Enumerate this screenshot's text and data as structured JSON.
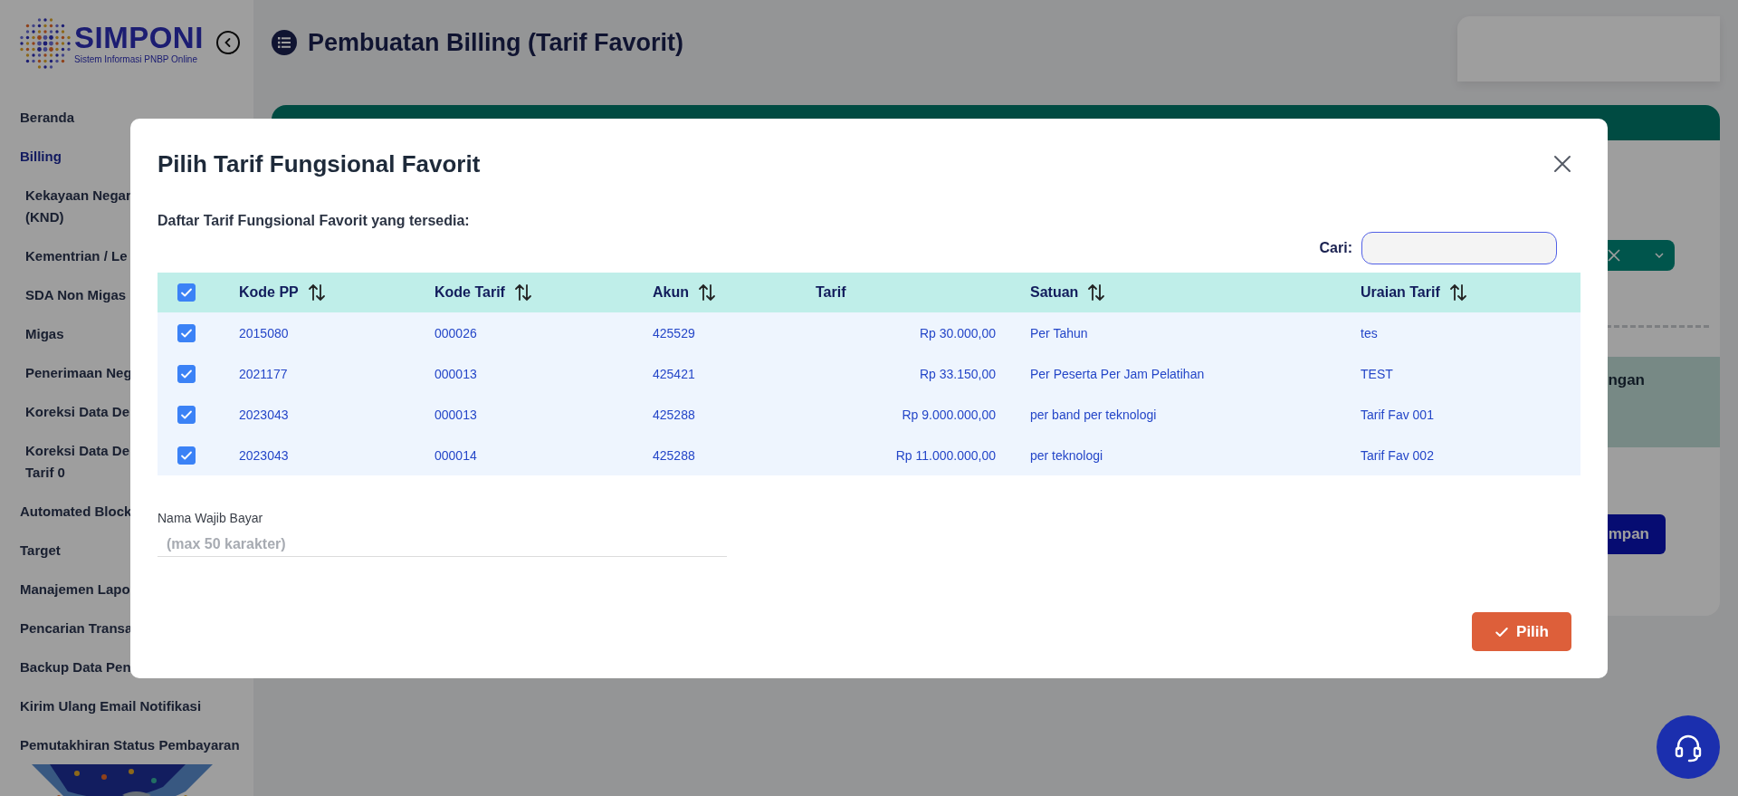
{
  "sidebar": {
    "logo": {
      "name": "SIMPONI",
      "tagline": "Sistem Informasi PNBP Online"
    },
    "items": [
      {
        "label": "Beranda",
        "selected": false
      },
      {
        "label": "Billing",
        "selected": true,
        "children": [
          {
            "label": "Kekayaan Negar\n(KND)"
          },
          {
            "label": "Kementrian / Le"
          },
          {
            "label": "SDA Non Migas"
          },
          {
            "label": "Migas"
          },
          {
            "label": "Penerimaan Neg"
          },
          {
            "label": "Koreksi Data De"
          },
          {
            "label": "Koreksi Data De\nTarif 0"
          }
        ]
      },
      {
        "label": "Automated Block",
        "selected": false
      },
      {
        "label": "Target",
        "selected": false
      },
      {
        "label": "Manajemen Lapo",
        "selected": false
      },
      {
        "label": "Pencarian Transa",
        "selected": false
      },
      {
        "label": "Backup Data Pen",
        "selected": false
      },
      {
        "label": "Kirim Ulang Email Notifikasi",
        "selected": false
      },
      {
        "label": "Pemutakhiran Status Pembayaran",
        "selected": false
      }
    ]
  },
  "page_title": "Pembuatan Billing (Tarif Favorit)",
  "card": {
    "panel_text": "ngan",
    "save_button": "mpan"
  },
  "modal": {
    "title": "Pilih Tarif Fungsional Favorit",
    "subtitle": "Daftar Tarif Fungsional Favorit yang tersedia:",
    "search": {
      "label": "Cari:"
    },
    "table": {
      "all_checked": true,
      "columns": [
        {
          "label": "Kode PP",
          "sortable": true,
          "kind": "text"
        },
        {
          "label": "Kode Tarif",
          "sortable": true,
          "kind": "text"
        },
        {
          "label": "Akun",
          "sortable": true,
          "kind": "text"
        },
        {
          "label": "Tarif",
          "sortable": false,
          "kind": "money"
        },
        {
          "label": "Satuan",
          "sortable": true,
          "kind": "text"
        },
        {
          "label": "Uraian Tarif",
          "sortable": true,
          "kind": "text"
        }
      ],
      "rows": [
        {
          "checked": true,
          "cells": [
            "2015080",
            "000026",
            "425529",
            "Rp 30.000,00",
            "Per Tahun",
            "tes"
          ]
        },
        {
          "checked": true,
          "cells": [
            "2021177",
            "000013",
            "425421",
            "Rp 33.150,00",
            "Per Peserta Per Jam Pelatihan",
            "TEST"
          ]
        },
        {
          "checked": true,
          "cells": [
            "2023043",
            "000013",
            "425288",
            "Rp 9.000.000,00",
            "per band per teknologi",
            "Tarif Fav 001"
          ]
        },
        {
          "checked": true,
          "cells": [
            "2023043",
            "000014",
            "425288",
            "Rp 11.000.000,00",
            "per teknologi",
            "Tarif Fav 002"
          ]
        }
      ]
    },
    "payer_field": {
      "label": "Nama Wajib Bayar",
      "placeholder": "(max 50 karakter)"
    },
    "submit_button": "Pilih"
  }
}
